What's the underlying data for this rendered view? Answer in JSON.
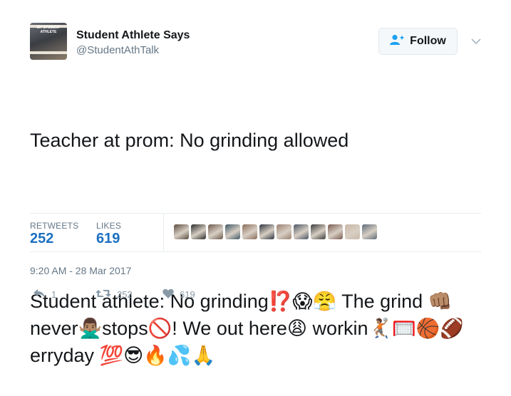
{
  "account": {
    "name": "Student Athlete Says",
    "handle": "@StudentAthTalk",
    "avatar_text": "MY STUDENT ATHLETE"
  },
  "follow_button": {
    "label": "Follow"
  },
  "tweet": {
    "line1": "Teacher at prom: No grinding allowed",
    "line2": "Student athlete: No grinding⁉️😱😤 The grind 👊🏽never🙅🏽‍♂️stops🚫! We out here😩 workin🤾🏽🥅🏀🏈erryday 💯😎🔥💦🙏"
  },
  "stats": {
    "retweets_label": "RETWEETS",
    "retweets_count": "252",
    "likes_label": "LIKES",
    "likes_count": "619"
  },
  "likers_colors": [
    "#5a4a3e",
    "#2b2b2b",
    "#6e5a4d",
    "#3f5866",
    "#8a6b5a",
    "#2e3440",
    "#9a8070",
    "#4b5563",
    "#3a3a3a",
    "#7a5c50",
    "#c9b8a8",
    "#5e6b78"
  ],
  "timestamp": "9:20 AM - 28 Mar 2017",
  "actions": {
    "reply_count": "1",
    "retweet_count": "252",
    "like_count": "619"
  },
  "colors": {
    "link_blue": "#1b6fc0",
    "follow_icon_blue": "#1da1f2",
    "muted": "#657786",
    "action_gray": "#8899a6"
  }
}
